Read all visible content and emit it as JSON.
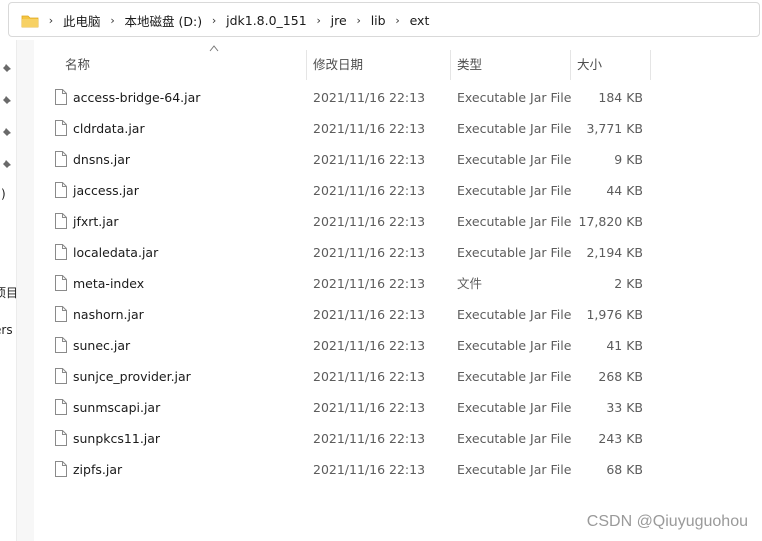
{
  "address": {
    "crumbs": [
      "此电脑",
      "本地磁盘 (D:)",
      "jdk1.8.0_151",
      "jre",
      "lib",
      "ext"
    ]
  },
  "nav": {
    "fragments": [
      ":)",
      "项目",
      "ers"
    ]
  },
  "columns": {
    "name": "名称",
    "date": "修改日期",
    "type": "类型",
    "size": "大小"
  },
  "files": [
    {
      "name": "access-bridge-64.jar",
      "date": "2021/11/16 22:13",
      "type": "Executable Jar File",
      "size": "184 KB"
    },
    {
      "name": "cldrdata.jar",
      "date": "2021/11/16 22:13",
      "type": "Executable Jar File",
      "size": "3,771 KB"
    },
    {
      "name": "dnsns.jar",
      "date": "2021/11/16 22:13",
      "type": "Executable Jar File",
      "size": "9 KB"
    },
    {
      "name": "jaccess.jar",
      "date": "2021/11/16 22:13",
      "type": "Executable Jar File",
      "size": "44 KB"
    },
    {
      "name": "jfxrt.jar",
      "date": "2021/11/16 22:13",
      "type": "Executable Jar File",
      "size": "17,820 KB"
    },
    {
      "name": "localedata.jar",
      "date": "2021/11/16 22:13",
      "type": "Executable Jar File",
      "size": "2,194 KB"
    },
    {
      "name": "meta-index",
      "date": "2021/11/16 22:13",
      "type": "文件",
      "size": "2 KB"
    },
    {
      "name": "nashorn.jar",
      "date": "2021/11/16 22:13",
      "type": "Executable Jar File",
      "size": "1,976 KB"
    },
    {
      "name": "sunec.jar",
      "date": "2021/11/16 22:13",
      "type": "Executable Jar File",
      "size": "41 KB"
    },
    {
      "name": "sunjce_provider.jar",
      "date": "2021/11/16 22:13",
      "type": "Executable Jar File",
      "size": "268 KB"
    },
    {
      "name": "sunmscapi.jar",
      "date": "2021/11/16 22:13",
      "type": "Executable Jar File",
      "size": "33 KB"
    },
    {
      "name": "sunpkcs11.jar",
      "date": "2021/11/16 22:13",
      "type": "Executable Jar File",
      "size": "243 KB"
    },
    {
      "name": "zipfs.jar",
      "date": "2021/11/16 22:13",
      "type": "Executable Jar File",
      "size": "68 KB"
    }
  ],
  "watermark": "CSDN @Qiuyuguohou",
  "colors": {
    "folder": "#f4c542",
    "folder_dark": "#e0a820",
    "header_text": "#4d4d4d",
    "secondary_text": "#5c5c5c"
  }
}
